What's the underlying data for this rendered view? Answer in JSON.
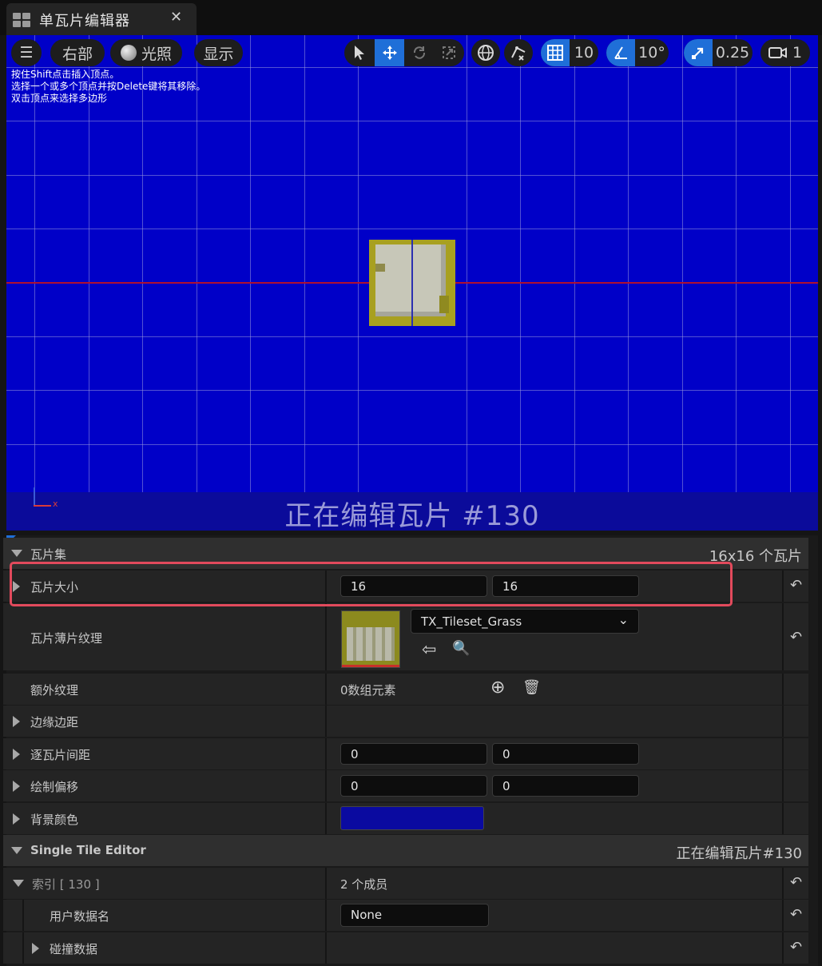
{
  "tab": {
    "title": "单瓦片编辑器",
    "close": "✕"
  },
  "toolbar": {
    "menu_icon": "☰",
    "view_label": "右部",
    "lighting_label": "光照",
    "show_label": "显示",
    "grid_snap_value": "10",
    "rotation_snap_value": "10°",
    "scale_snap_value": "0.25",
    "camera_speed_value": "1"
  },
  "viewport": {
    "hint_lines": [
      "按住Shift点击插入顶点。",
      "选择一个或多个顶点并按Delete键将其移除。",
      "双击顶点来选择多边形"
    ],
    "status": "正在编辑瓦片 #130",
    "background_color": "#0000c8",
    "axis_label": "x"
  },
  "details": {
    "tileset_section": {
      "label": "瓦片集",
      "info": "16x16 个瓦片"
    },
    "tile_size": {
      "label": "瓦片大小",
      "x": "16",
      "y": "16"
    },
    "tile_sheet_texture": {
      "label": "瓦片薄片纹理",
      "value": "TX_Tileset_Grass"
    },
    "additional_textures": {
      "label": "额外纹理",
      "value": "0数组元素"
    },
    "border_margin": {
      "label": "边缘边距"
    },
    "per_tile_spacing": {
      "label": "逐瓦片间距",
      "x": "0",
      "y": "0"
    },
    "drawing_offset": {
      "label": "绘制偏移",
      "x": "0",
      "y": "0"
    },
    "background_color": {
      "label": "背景颜色",
      "color": "#0a0aa0"
    },
    "single_tile_section": {
      "label": "Single Tile Editor",
      "info": "正在编辑瓦片#130"
    },
    "index": {
      "label": "索引 [ 130 ]",
      "value": "2 个成员"
    },
    "user_data_name": {
      "label": "用户数据名",
      "value": "None"
    },
    "collision_data": {
      "label": "碰撞数据"
    }
  },
  "icons": {
    "reset": "↶",
    "add": "⊕",
    "trash": "🗑",
    "use_selected": "⇦",
    "browse": "🔍"
  }
}
